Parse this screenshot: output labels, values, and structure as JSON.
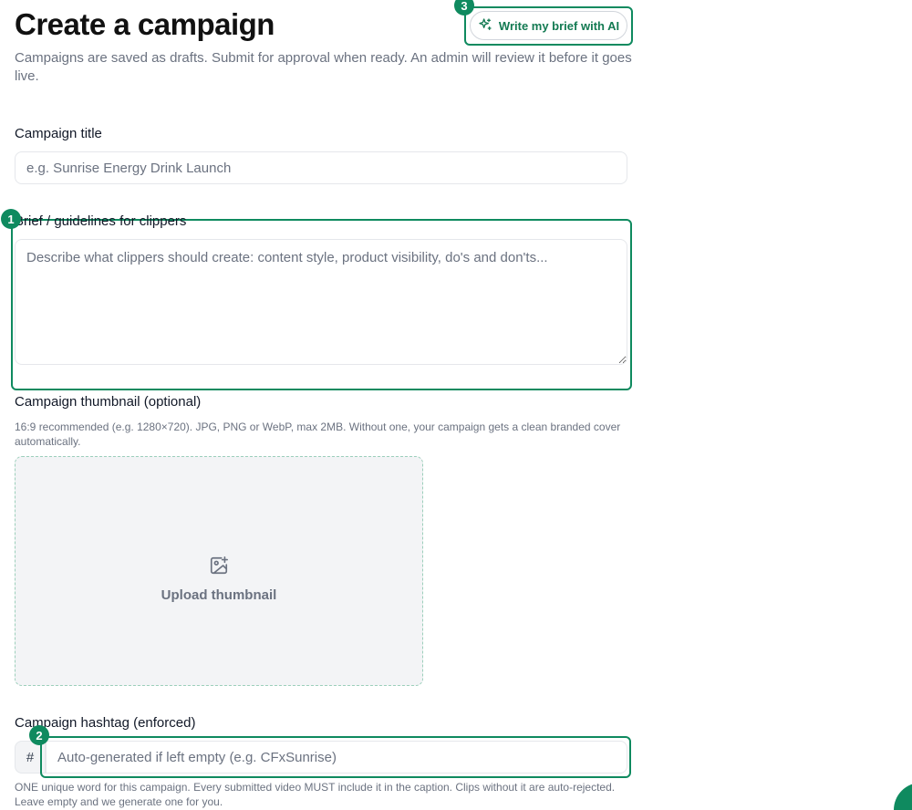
{
  "page": {
    "title": "Create a campaign",
    "subtitle": "Campaigns are saved as drafts. Submit for approval when ready. An admin will review it before it goes live."
  },
  "ai_button": {
    "label": "Write my brief with AI",
    "icon": "sparkles-icon",
    "badge": "3"
  },
  "campaign_title": {
    "label": "Campaign title",
    "placeholder": "e.g. Sunrise Energy Drink Launch",
    "value": ""
  },
  "brief": {
    "label": "Brief / guidelines for clippers",
    "placeholder": "Describe what clippers should create: content style, product visibility, do's and don'ts...",
    "value": "",
    "badge": "1"
  },
  "thumbnail": {
    "label": "Campaign thumbnail (optional)",
    "help": "16:9 recommended (e.g. 1280×720). JPG, PNG or WebP, max 2MB. Without one, your campaign gets a clean branded cover automatically.",
    "upload_label": "Upload thumbnail",
    "icon": "image-plus-icon"
  },
  "hashtag": {
    "label": "Campaign hashtag (enforced)",
    "prefix": "#",
    "placeholder": "Auto-generated if left empty (e.g. CFxSunrise)",
    "value": "",
    "badge": "2",
    "help": "ONE unique word for this campaign. Every submitted video MUST include it in the caption. Clips without it are auto-rejected. Leave empty and we generate one for you."
  },
  "colors": {
    "accent": "#0f8a5f",
    "muted_text": "#6b7280",
    "upload_bg": "#f3f4f6"
  }
}
